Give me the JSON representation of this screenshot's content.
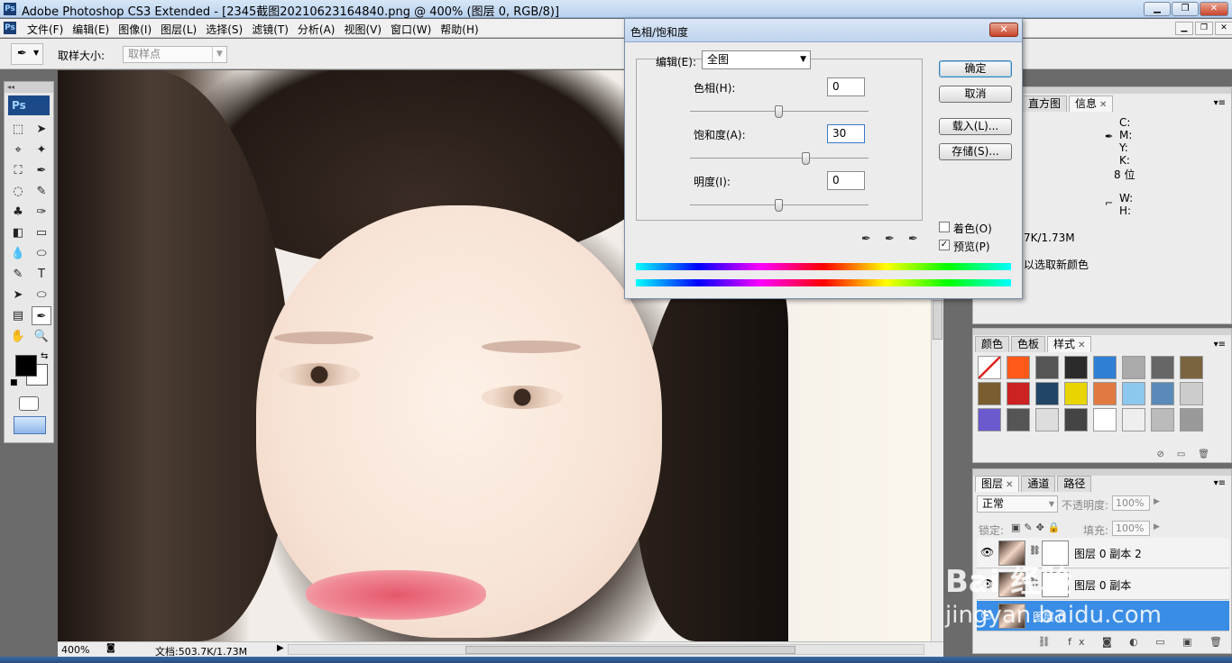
{
  "window": {
    "title": "Adobe Photoshop CS3 Extended - [2345截图20210623164840.png @ 400% (图层 0, RGB/8)]",
    "buttons": [
      "▁",
      "❐",
      "✕"
    ]
  },
  "menu": {
    "items": [
      "文件(F)",
      "编辑(E)",
      "图像(I)",
      "图层(L)",
      "选择(S)",
      "滤镜(T)",
      "分析(A)",
      "视图(V)",
      "窗口(W)",
      "帮助(H)"
    ],
    "mdi_buttons": [
      "▁",
      "❐",
      "✕"
    ]
  },
  "options_bar": {
    "sample_size_label": "取样大小:",
    "sample_size_value": "取样点"
  },
  "toolbox": {
    "logo": "Ps",
    "tools": [
      "⬚",
      "➤",
      "⌖",
      "✦",
      "⛶",
      "✒",
      "◌",
      "✎",
      "♣",
      "✑",
      "◧",
      "▭",
      "💧",
      "⬭",
      "✎",
      "T",
      "➤",
      "⬭",
      "▤",
      "✒",
      "✋",
      "🔍"
    ]
  },
  "canvas": {
    "description_alt": "portrait"
  },
  "status": {
    "zoom": "400%",
    "doc": "文档:503.7K/1.73M"
  },
  "dialog": {
    "title": "色相/饱和度",
    "close": "✕",
    "edit_label": "编辑(E):",
    "edit_value": "全图",
    "hue_label": "色相(H):",
    "hue_value": "0",
    "saturation_label": "饱和度(A):",
    "saturation_value": "30",
    "lightness_label": "明度(I):",
    "lightness_value": "0",
    "ok": "确定",
    "cancel": "取消",
    "load": "载入(L)...",
    "save": "存储(S)...",
    "colorize_label": "着色(O)",
    "colorize_checked": false,
    "preview_label": "预览(P)",
    "preview_checked": true
  },
  "info_panel": {
    "tabs": [
      "直方图",
      "信息"
    ],
    "cmyk_labels": [
      "C:",
      "M:",
      "Y:",
      "K:"
    ],
    "bits": "8 位",
    "wh_labels": [
      "W:",
      "H:"
    ],
    "doc_partial": "7K/1.73M",
    "hint_partial": "以选取新颜色"
  },
  "style_panel": {
    "tabs": [
      "颜色",
      "色板",
      "样式"
    ],
    "swatch_colors": [
      "#ffffff",
      "#ff5a1a",
      "#555555",
      "#2b2b2b",
      "#2f7fd4",
      "#aaaaaa",
      "#666666",
      "#7a6440",
      "#7a5e30",
      "#cc2222",
      "#224466",
      "#e8d400",
      "#e07a40",
      "#8cc8ee",
      "#5a8ab8",
      "#cccccc",
      "#6a5acd",
      "#555555",
      "#dddddd",
      "#444444",
      "#ffffff",
      "#eeeeee",
      "#bbbbbb",
      "#999999"
    ]
  },
  "layers_panel": {
    "tabs": [
      "图层",
      "通道",
      "路径"
    ],
    "blend_mode": "正常",
    "opacity_label": "不透明度:",
    "opacity_value": "100%",
    "lock_label": "锁定:",
    "fill_label": "填充:",
    "fill_value": "100%",
    "layers": [
      {
        "name": "图层 0 副本 2",
        "selected": false
      },
      {
        "name": "图层 0 副本",
        "selected": false
      },
      {
        "name": "图层 0",
        "selected": true
      }
    ],
    "footer_icons": "⛓ fx ◙ ◐ ▭ ▣ 🗑"
  },
  "watermark": {
    "text": "Bai 经验",
    "url": "jingyan.baidu.com"
  }
}
